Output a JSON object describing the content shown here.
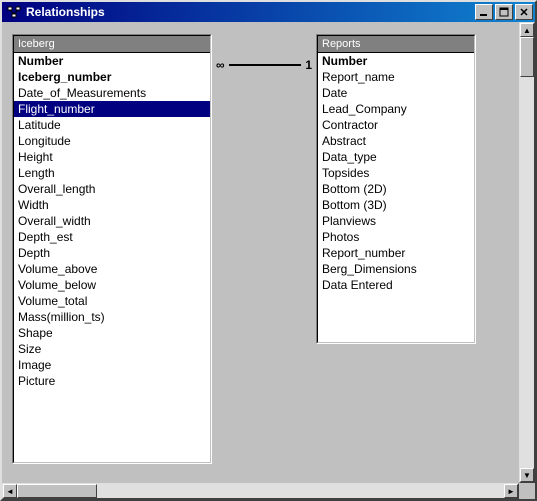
{
  "window": {
    "title": "Relationships"
  },
  "tables": {
    "iceberg": {
      "title": "Iceberg",
      "fields": [
        "Number",
        "Iceberg_number",
        "Date_of_Measurements",
        "Flight_number",
        "Latitude",
        "Longitude",
        "Height",
        "Length",
        "Overall_length",
        "Width",
        "Overall_width",
        "Depth_est",
        "Depth",
        "Volume_above",
        "Volume_below",
        "Volume_total",
        "Mass(million_ts)",
        "Shape",
        "Size",
        "Image",
        "Picture"
      ],
      "bold_indices": [
        0,
        1
      ],
      "selected_index": 3
    },
    "reports": {
      "title": "Reports",
      "fields": [
        "Number",
        "Report_name",
        "Date",
        "Lead_Company",
        "Contractor",
        "Abstract",
        "Data_type",
        "Topsides",
        "Bottom (2D)",
        "Bottom (3D)",
        "Planviews",
        "Photos",
        "Report_number",
        "Berg_Dimensions",
        "Data Entered"
      ],
      "bold_indices": [
        0
      ],
      "selected_index": -1
    }
  },
  "relation": {
    "left_symbol": "∞",
    "right_symbol": "1"
  }
}
